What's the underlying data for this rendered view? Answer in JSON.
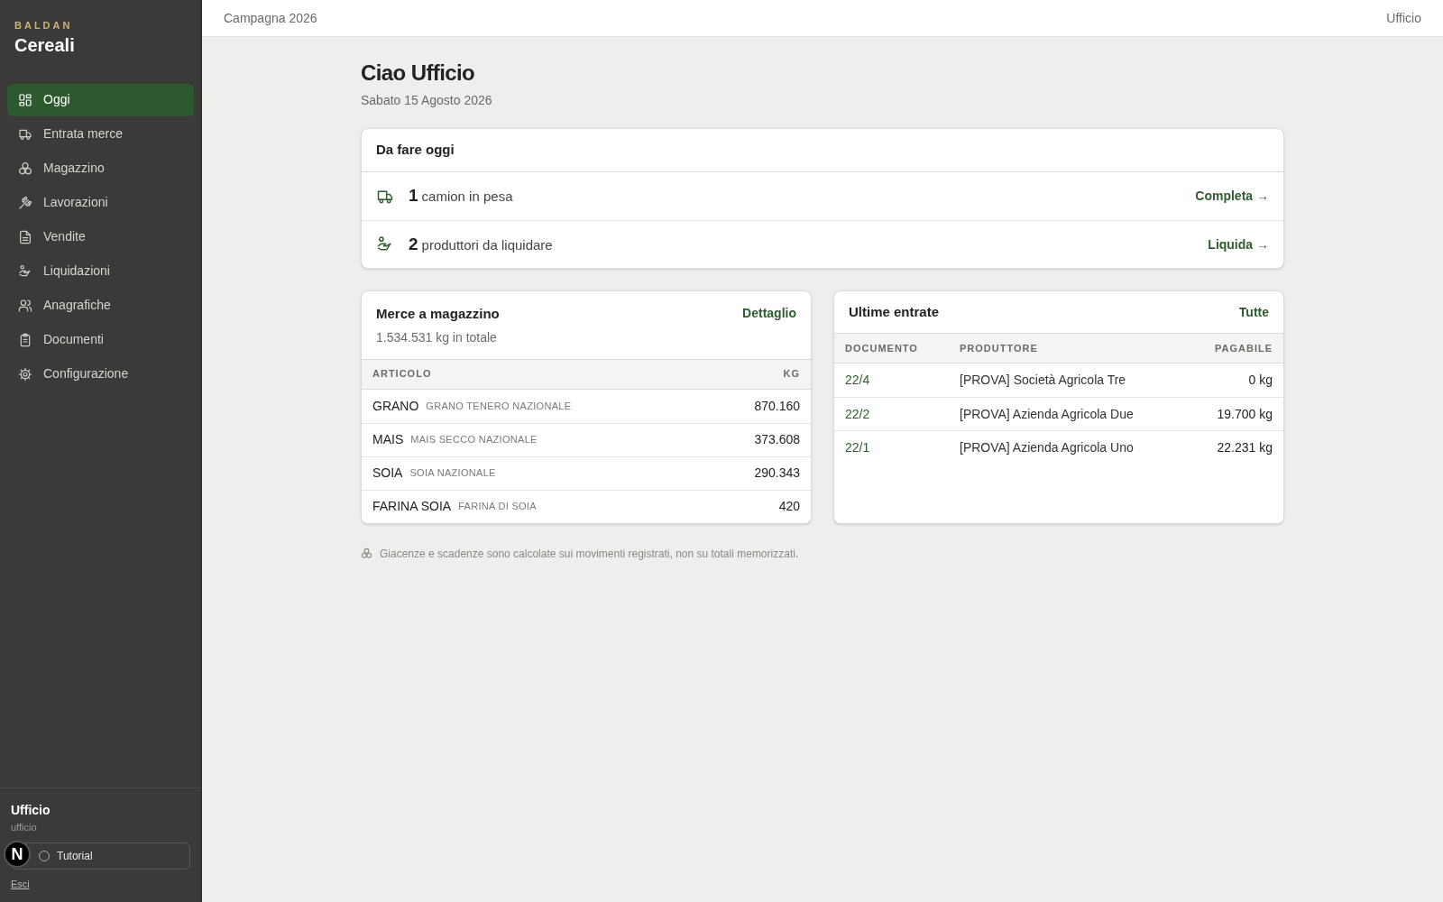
{
  "brand": {
    "overline": "BALDAN",
    "name": "Cereali"
  },
  "sidebar": {
    "items": [
      {
        "label": "Oggi",
        "selected": true
      },
      {
        "label": "Entrata merce",
        "selected": false
      },
      {
        "label": "Magazzino",
        "selected": false
      },
      {
        "label": "Lavorazioni",
        "selected": false
      },
      {
        "label": "Vendite",
        "selected": false
      },
      {
        "label": "Liquidazioni",
        "selected": false
      },
      {
        "label": "Anagrafiche",
        "selected": false
      },
      {
        "label": "Documenti",
        "selected": false
      },
      {
        "label": "Configurazione",
        "selected": false
      }
    ],
    "user": {
      "name": "Ufficio",
      "role": "ufficio",
      "tutorial": "Tutorial",
      "logout": "Esci"
    },
    "overlay_badge": "N"
  },
  "topbar": {
    "campaign": "Campagna 2026",
    "user": "Ufficio"
  },
  "greeting": {
    "title": "Ciao Ufficio",
    "date": "Sabato 15 Agosto 2026"
  },
  "todo": {
    "title": "Da fare oggi",
    "items": [
      {
        "count": "1",
        "text": "camion in pesa",
        "action": "Completa →"
      },
      {
        "count": "2",
        "text": "produttori da liquidare",
        "action": "Liquida →"
      }
    ]
  },
  "stock": {
    "title": "Merce a magazzino",
    "subtitle": "1.534.531 kg in totale",
    "link": "Dettaglio",
    "columns": [
      "ARTICOLO",
      "KG"
    ],
    "rows": [
      {
        "code": "GRANO",
        "description": "GRANO TENERO NAZIONALE",
        "kg": "870.160"
      },
      {
        "code": "MAIS",
        "description": "MAIS SECCO NAZIONALE",
        "kg": "373.608"
      },
      {
        "code": "SOIA",
        "description": "SOIA NAZIONALE",
        "kg": "290.343"
      },
      {
        "code": "FARINA SOIA",
        "description": "FARINA DI SOIA",
        "kg": "420"
      }
    ]
  },
  "entries": {
    "title": "Ultime entrate",
    "link": "Tutte",
    "columns": [
      "DOCUMENTO",
      "PRODUTTORE",
      "PAGABILE"
    ],
    "rows": [
      {
        "document": "22/4",
        "producer": "[PROVA] Società Agricola Tre",
        "payable": "0 kg"
      },
      {
        "document": "22/2",
        "producer": "[PROVA] Azienda Agricola Due",
        "payable": "19.700 kg"
      },
      {
        "document": "22/1",
        "producer": "[PROVA] Azienda Agricola Uno",
        "payable": "22.231 kg"
      }
    ]
  },
  "footnote": "Giacenze e scadenze sono calcolate sui movimenti registrati, non su totali memorizzati."
}
